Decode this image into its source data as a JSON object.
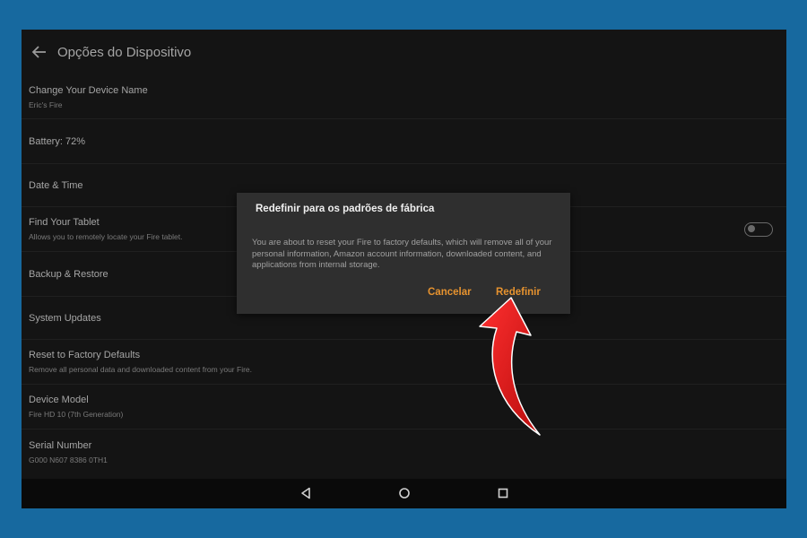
{
  "header": {
    "title": "Opções do Dispositivo",
    "back_icon": "arrow-left-icon"
  },
  "settings": [
    {
      "title": "Change Your Device Name",
      "subtitle": "Eric's Fire"
    },
    {
      "title": "Battery: 72%",
      "subtitle": ""
    },
    {
      "title": "Date & Time",
      "subtitle": ""
    },
    {
      "title": "Find Your Tablet",
      "subtitle": "Allows you to remotely locate your Fire tablet.",
      "toggle": false
    },
    {
      "title": "Backup & Restore",
      "subtitle": ""
    },
    {
      "title": "System Updates",
      "subtitle": ""
    },
    {
      "title": "Reset to Factory Defaults",
      "subtitle": "Remove all personal data and downloaded content from your Fire."
    },
    {
      "title": "Device Model",
      "subtitle": "Fire HD 10 (7th Generation)"
    },
    {
      "title": "Serial Number",
      "subtitle": "G000 N607 8386 0TH1"
    }
  ],
  "dialog": {
    "title": "Redefinir para os padrões de fábrica",
    "body": "You are about to reset your Fire to factory defaults, which will remove all of your personal information, Amazon account information, downloaded content, and applications from internal storage.",
    "cancel_label": "Cancelar",
    "confirm_label": "Redefinir"
  },
  "navbar": {
    "back_icon": "triangle-back-icon",
    "home_icon": "circle-home-icon",
    "recents_icon": "square-recents-icon"
  },
  "colors": {
    "accent": "#e7932f",
    "annotation_arrow": "#e01818",
    "background": "#17699f"
  }
}
